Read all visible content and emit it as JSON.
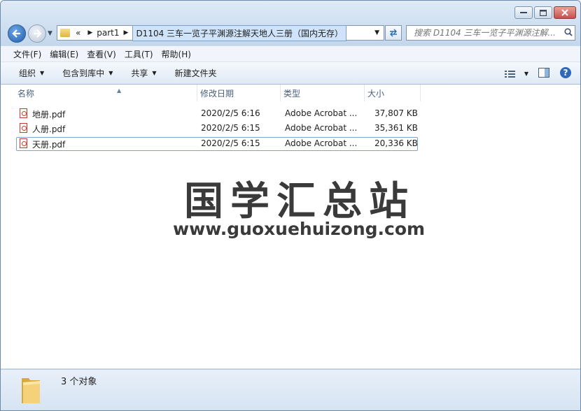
{
  "window": {
    "caption_buttons": [
      "minimize",
      "maximize",
      "close"
    ]
  },
  "address": {
    "root_chevron": "«",
    "crumb_parent": "part1",
    "crumb_current": "D1104 三车一览子平渊源注解天地人三册（国内无存）"
  },
  "search": {
    "placeholder": "搜索 D1104 三车一览子平渊源注解..."
  },
  "menubar": [
    {
      "label": "文件(F)"
    },
    {
      "label": "编辑(E)"
    },
    {
      "label": "查看(V)"
    },
    {
      "label": "工具(T)"
    },
    {
      "label": "帮助(H)"
    }
  ],
  "toolbar": {
    "organize": "组织",
    "include_library": "包含到库中",
    "share": "共享",
    "new_folder": "新建文件夹"
  },
  "columns": {
    "name": "名称",
    "modified": "修改日期",
    "type": "类型",
    "size": "大小"
  },
  "files": [
    {
      "name": "地册.pdf",
      "modified": "2020/2/5 6:16",
      "type": "Adobe Acrobat ...",
      "size": "37,807 KB"
    },
    {
      "name": "人册.pdf",
      "modified": "2020/2/5 6:15",
      "type": "Adobe Acrobat ...",
      "size": "35,361 KB"
    },
    {
      "name": "天册.pdf",
      "modified": "2020/2/5 6:15",
      "type": "Adobe Acrobat ...",
      "size": "20,336 KB",
      "selected": true
    }
  ],
  "watermark": {
    "title": "国学汇总站",
    "url": "www.guoxuehuizong.com"
  },
  "status": {
    "count_text": "3 个对象"
  },
  "colors": {
    "accent": "#2c6bb6",
    "selection_border": "#7da2ce",
    "pdf_red": "#c43a2c"
  }
}
